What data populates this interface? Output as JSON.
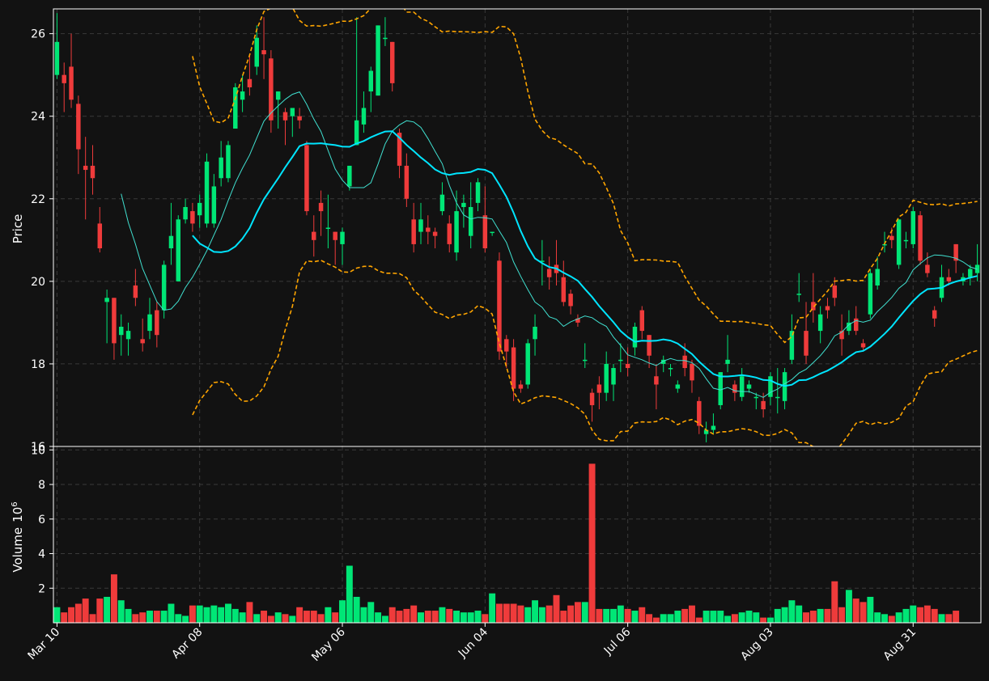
{
  "colors": {
    "background": "#121212",
    "up": "#00e676",
    "down": "#ef3b3b",
    "ma_fast": "#40e0d0",
    "ma_slow": "#00e5ff",
    "band": "#ffa500",
    "grid": "#3a3a3a",
    "axis": "#ffffff"
  },
  "chart_data": [
    {
      "type": "candlestick",
      "panel": "price",
      "ylabel": "Price",
      "ylim": [
        16,
        26.6
      ],
      "yticks": [
        16,
        18,
        20,
        22,
        24,
        26
      ],
      "grid": true,
      "x_tick_labels": [
        "Mar 10",
        "Apr 08",
        "May 06",
        "Jun 04",
        "Jul 06",
        "Aug 03",
        "Aug 31"
      ],
      "x_tick_index": [
        0,
        20,
        40,
        60,
        80,
        100,
        120
      ],
      "candles": [
        [
          25,
          25.8,
          26.5,
          24.9
        ],
        [
          25,
          24.8,
          25.3,
          24.1
        ],
        [
          25.2,
          24.4,
          26,
          24.2
        ],
        [
          24.3,
          23.2,
          24.5,
          22.6
        ],
        [
          22.8,
          22.7,
          23.5,
          21.5
        ],
        [
          22.8,
          22.5,
          23.3,
          22.1
        ],
        [
          21.4,
          20.8,
          21.8,
          20.7
        ],
        [
          19.5,
          19.6,
          19.8,
          18.5
        ],
        [
          19.6,
          18.5,
          19.6,
          18.1
        ],
        [
          18.7,
          18.9,
          19.2,
          18.2
        ],
        [
          18.6,
          18.8,
          19,
          18.2
        ],
        [
          19.9,
          19.6,
          20.3,
          19.4
        ],
        [
          18.6,
          18.5,
          19.1,
          18.3
        ],
        [
          18.8,
          19.2,
          19.6,
          18.6
        ],
        [
          19.3,
          18.7,
          19.5,
          18.4
        ],
        [
          19.3,
          20.4,
          20.5,
          19.1
        ],
        [
          20.8,
          21.1,
          21.9,
          20.4
        ],
        [
          20,
          21.5,
          21.6,
          20
        ],
        [
          21.5,
          21.8,
          22,
          21.4
        ],
        [
          21.7,
          21.4,
          21.9,
          21.2
        ],
        [
          21.6,
          21.9,
          22.1,
          21.3
        ],
        [
          21.4,
          22.9,
          23.1,
          21.3
        ],
        [
          21.4,
          22.3,
          22.6,
          21.3
        ],
        [
          22.5,
          23,
          23.4,
          22.3
        ],
        [
          22.5,
          23.3,
          23.4,
          22.4
        ],
        [
          23.7,
          24.7,
          24.8,
          23.7
        ],
        [
          24.4,
          24.6,
          25,
          24.1
        ],
        [
          24.9,
          24.7,
          25.5,
          24.5
        ],
        [
          25.2,
          25.9,
          26.2,
          25
        ],
        [
          25.6,
          25.5,
          26.4,
          24.9
        ],
        [
          25.4,
          23.9,
          25.6,
          23.6
        ],
        [
          24.4,
          24.6,
          24.6,
          23.7
        ],
        [
          24.1,
          23.9,
          24.2,
          23.3
        ],
        [
          24,
          24.2,
          24.2,
          23.5
        ],
        [
          24,
          23.9,
          24.2,
          23.7
        ],
        [
          23.3,
          21.7,
          23.4,
          21.6
        ],
        [
          21.2,
          21,
          21.6,
          20.6
        ],
        [
          21.9,
          21.7,
          22.2,
          21.1
        ],
        [
          21.3,
          21.3,
          22.1,
          20.8
        ],
        [
          21.2,
          21,
          21.2,
          20.4
        ],
        [
          20.9,
          21.2,
          21.3,
          20.4
        ],
        [
          22.3,
          22.8,
          22.8,
          22.2
        ],
        [
          23.3,
          23.9,
          26.4,
          23.3
        ],
        [
          23.8,
          24.2,
          24.6,
          23.6
        ],
        [
          24.6,
          25.1,
          25.2,
          24.1
        ],
        [
          24.5,
          26.2,
          26.2,
          24.5
        ],
        [
          25.9,
          25.9,
          26.4,
          25.7
        ],
        [
          25.8,
          24.8,
          25.8,
          24.6
        ],
        [
          23.6,
          22.8,
          23.7,
          22.5
        ],
        [
          22.8,
          22,
          23.1,
          21.8
        ],
        [
          21.5,
          20.9,
          21.9,
          20.7
        ],
        [
          21.2,
          21.5,
          21.9,
          20.9
        ],
        [
          21.3,
          21.2,
          21.6,
          20.9
        ],
        [
          21.2,
          21.1,
          21.3,
          20.8
        ],
        [
          21.7,
          22.1,
          22.4,
          21.6
        ],
        [
          21.4,
          20.9,
          21.6,
          20.7
        ],
        [
          20.7,
          21.7,
          22.2,
          20.5
        ],
        [
          21.8,
          21.9,
          22.1,
          21.3
        ],
        [
          21.1,
          21.8,
          22.4,
          20.8
        ],
        [
          21.9,
          22.4,
          22.5,
          21.7
        ],
        [
          21.6,
          20.8,
          22.3,
          20.7
        ],
        [
          21.2,
          21.2,
          21.2,
          21.1
        ],
        [
          20.5,
          18.3,
          20.7,
          18.1
        ],
        [
          18.6,
          18.3,
          18.7,
          17.9
        ],
        [
          18.4,
          17.4,
          18.6,
          17.1
        ],
        [
          17.5,
          17.4,
          17.6,
          17.3
        ],
        [
          17.5,
          18.5,
          18.6,
          17.4
        ],
        [
          18.6,
          18.9,
          19.2,
          18.2
        ],
        [
          20.5,
          20.5,
          21,
          19.9
        ],
        [
          20.3,
          20.1,
          20.6,
          19.8
        ],
        [
          20.4,
          20.2,
          21,
          19.9
        ],
        [
          20.1,
          19.5,
          20.5,
          19.4
        ],
        [
          19.7,
          19.4,
          19.8,
          19.2
        ],
        [
          19.1,
          19,
          19.2,
          18.9
        ],
        [
          18.1,
          18.1,
          18.5,
          17.9
        ],
        [
          17.3,
          17,
          17.4,
          16.6
        ],
        [
          17.5,
          17.3,
          17.7,
          16.9
        ],
        [
          17.3,
          18,
          18.3,
          17.1
        ],
        [
          17.5,
          17.9,
          18,
          17.1
        ],
        [
          18.1,
          18.1,
          18.5,
          17.8
        ],
        [
          18,
          17.9,
          18.4,
          17.7
        ],
        [
          18.4,
          18.9,
          19,
          18.2
        ],
        [
          19.3,
          18.8,
          19.4,
          18.6
        ],
        [
          18.7,
          18.2,
          18.7,
          17.9
        ],
        [
          17.7,
          17.5,
          18,
          16.9
        ],
        [
          18,
          18.1,
          18.2,
          17.8
        ],
        [
          17.9,
          17.9,
          18,
          17.7
        ],
        [
          17.4,
          17.5,
          17.6,
          17.3
        ],
        [
          18.2,
          17.9,
          18.5,
          17.7
        ],
        [
          18,
          17.6,
          18.1,
          17.3
        ],
        [
          17.1,
          16.5,
          17.2,
          16.3
        ],
        [
          16.3,
          16.4,
          16.6,
          16.1
        ],
        [
          16.4,
          16.5,
          16.8,
          16.3
        ],
        [
          17,
          17.8,
          17.8,
          16.9
        ],
        [
          18,
          18.1,
          18.7,
          17.8
        ],
        [
          17.5,
          17.3,
          17.6,
          17.1
        ],
        [
          17.2,
          17.7,
          17.9,
          17.1
        ],
        [
          17.4,
          17.5,
          17.6,
          17.3
        ],
        [
          17.2,
          17.2,
          17.3,
          16.9
        ],
        [
          17.1,
          16.9,
          17.3,
          16.7
        ],
        [
          17.2,
          17.7,
          17.8,
          17
        ],
        [
          17.2,
          17.2,
          17.9,
          16.8
        ],
        [
          17.1,
          17.8,
          17.9,
          16.9
        ],
        [
          18.1,
          18.8,
          19.2,
          18
        ],
        [
          19.7,
          19.7,
          20.2,
          19.5
        ],
        [
          18.8,
          18.2,
          19.5,
          18
        ],
        [
          19.5,
          19.3,
          20.2,
          19
        ],
        [
          18.8,
          19.2,
          19.4,
          18.5
        ],
        [
          19.4,
          19.3,
          19.6,
          19.1
        ],
        [
          19.9,
          19.6,
          20.1,
          19.4
        ],
        [
          18.8,
          18.6,
          19.2,
          18.2
        ],
        [
          18.8,
          19,
          19.3,
          18.7
        ],
        [
          19.1,
          18.8,
          19.4,
          18.7
        ],
        [
          18.5,
          18.4,
          18.6,
          18.3
        ],
        [
          19.2,
          20.2,
          20.3,
          19.1
        ],
        [
          19.9,
          20.3,
          20.6,
          19.8
        ],
        [
          20.9,
          20.9,
          21.2,
          20.7
        ],
        [
          21.1,
          21,
          21.3,
          20.8
        ],
        [
          20.4,
          21.5,
          21.5,
          20.3
        ],
        [
          21,
          21,
          21.2,
          20.8
        ],
        [
          20.9,
          21.7,
          21.8,
          20.8
        ],
        [
          21.6,
          20.5,
          21.7,
          20.4
        ],
        [
          20.4,
          20.2,
          20.7,
          20.1
        ],
        [
          19.3,
          19.1,
          19.4,
          18.9
        ],
        [
          19.6,
          20.1,
          20.4,
          19.5
        ],
        [
          20.1,
          20,
          20.3,
          19.9
        ],
        [
          20.9,
          20.5,
          20.9,
          20.2
        ],
        [
          20,
          20.1,
          20.2,
          19.9
        ],
        [
          20.1,
          20.3,
          20.4,
          19.9
        ],
        [
          20.2,
          20.4,
          20.9,
          20
        ]
      ],
      "ma_fast": [
        null,
        null,
        null,
        null,
        null,
        null,
        null,
        null,
        null,
        null,
        null,
        null,
        null,
        null,
        null,
        null,
        null,
        null,
        null,
        null,
        null,
        null,
        null,
        null,
        null,
        null,
        null,
        null,
        null,
        null,
        null,
        null,
        null,
        null,
        null,
        null,
        null,
        null,
        null,
        null,
        null,
        null,
        null,
        null,
        null,
        null,
        null,
        null,
        null,
        null,
        null,
        null,
        null,
        null,
        null,
        null,
        null,
        null,
        null,
        null,
        null,
        null,
        null,
        null,
        null,
        null,
        null,
        null,
        null,
        null,
        null,
        null,
        null,
        null,
        null,
        null,
        null,
        null,
        null,
        null,
        null,
        null,
        null,
        null,
        null,
        null,
        null,
        null,
        null,
        null,
        null,
        null,
        null,
        null,
        null,
        null,
        null,
        null,
        null,
        null,
        null,
        null,
        null,
        null,
        null,
        null,
        null,
        null,
        null,
        null,
        null,
        null,
        null,
        null,
        null,
        null,
        null,
        null,
        null,
        null,
        null,
        null,
        null,
        null,
        null,
        null,
        null,
        null,
        null,
        null
      ],
      "ma_slow": [],
      "band_upper": [],
      "band_lower": []
    },
    {
      "type": "bar",
      "panel": "volume",
      "ylabel": "Volume",
      "ylabel_exponent": "6",
      "ylim": [
        0,
        10.2
      ],
      "yticks": [
        2,
        4,
        6,
        8,
        10
      ],
      "grid": true,
      "volumes": [
        0.9,
        0.6,
        0.9,
        1.1,
        1.4,
        0.5,
        1.4,
        1.5,
        2.8,
        1.3,
        0.8,
        0.5,
        0.6,
        0.7,
        0.7,
        0.7,
        1.1,
        0.5,
        0.4,
        1,
        1,
        0.9,
        1,
        0.9,
        1.1,
        0.8,
        0.6,
        1.2,
        0.5,
        0.7,
        0.4,
        0.6,
        0.5,
        0.4,
        0.9,
        0.7,
        0.7,
        0.5,
        0.9,
        0.6,
        1.3,
        3.3,
        1.5,
        0.9,
        1.2,
        0.6,
        0.4,
        0.9,
        0.7,
        0.8,
        1,
        0.6,
        0.7,
        0.7,
        0.9,
        0.8,
        0.7,
        0.6,
        0.6,
        0.7,
        0.5,
        1.7,
        1.1,
        1.1,
        1.1,
        1,
        0.9,
        1.3,
        0.9,
        1,
        1.6,
        0.7,
        1,
        1.2,
        1.2,
        9.2,
        0.8,
        0.8,
        0.8,
        1,
        0.8,
        0.7,
        0.9,
        0.5,
        0.3,
        0.5,
        0.5,
        0.7,
        0.8,
        1,
        0.3,
        0.7,
        0.7,
        0.7,
        0.4,
        0.5,
        0.6,
        0.7,
        0.6,
        0.3,
        0.3,
        0.8,
        0.9,
        1.3,
        1,
        0.6,
        0.7,
        0.8,
        0.8,
        2.4,
        0.9,
        1.9,
        1.4,
        1.2,
        1.5,
        0.6,
        0.5,
        0.4,
        0.6,
        0.8,
        1,
        0.9,
        1,
        0.8,
        0.5,
        0.5,
        0.7
      ]
    }
  ]
}
